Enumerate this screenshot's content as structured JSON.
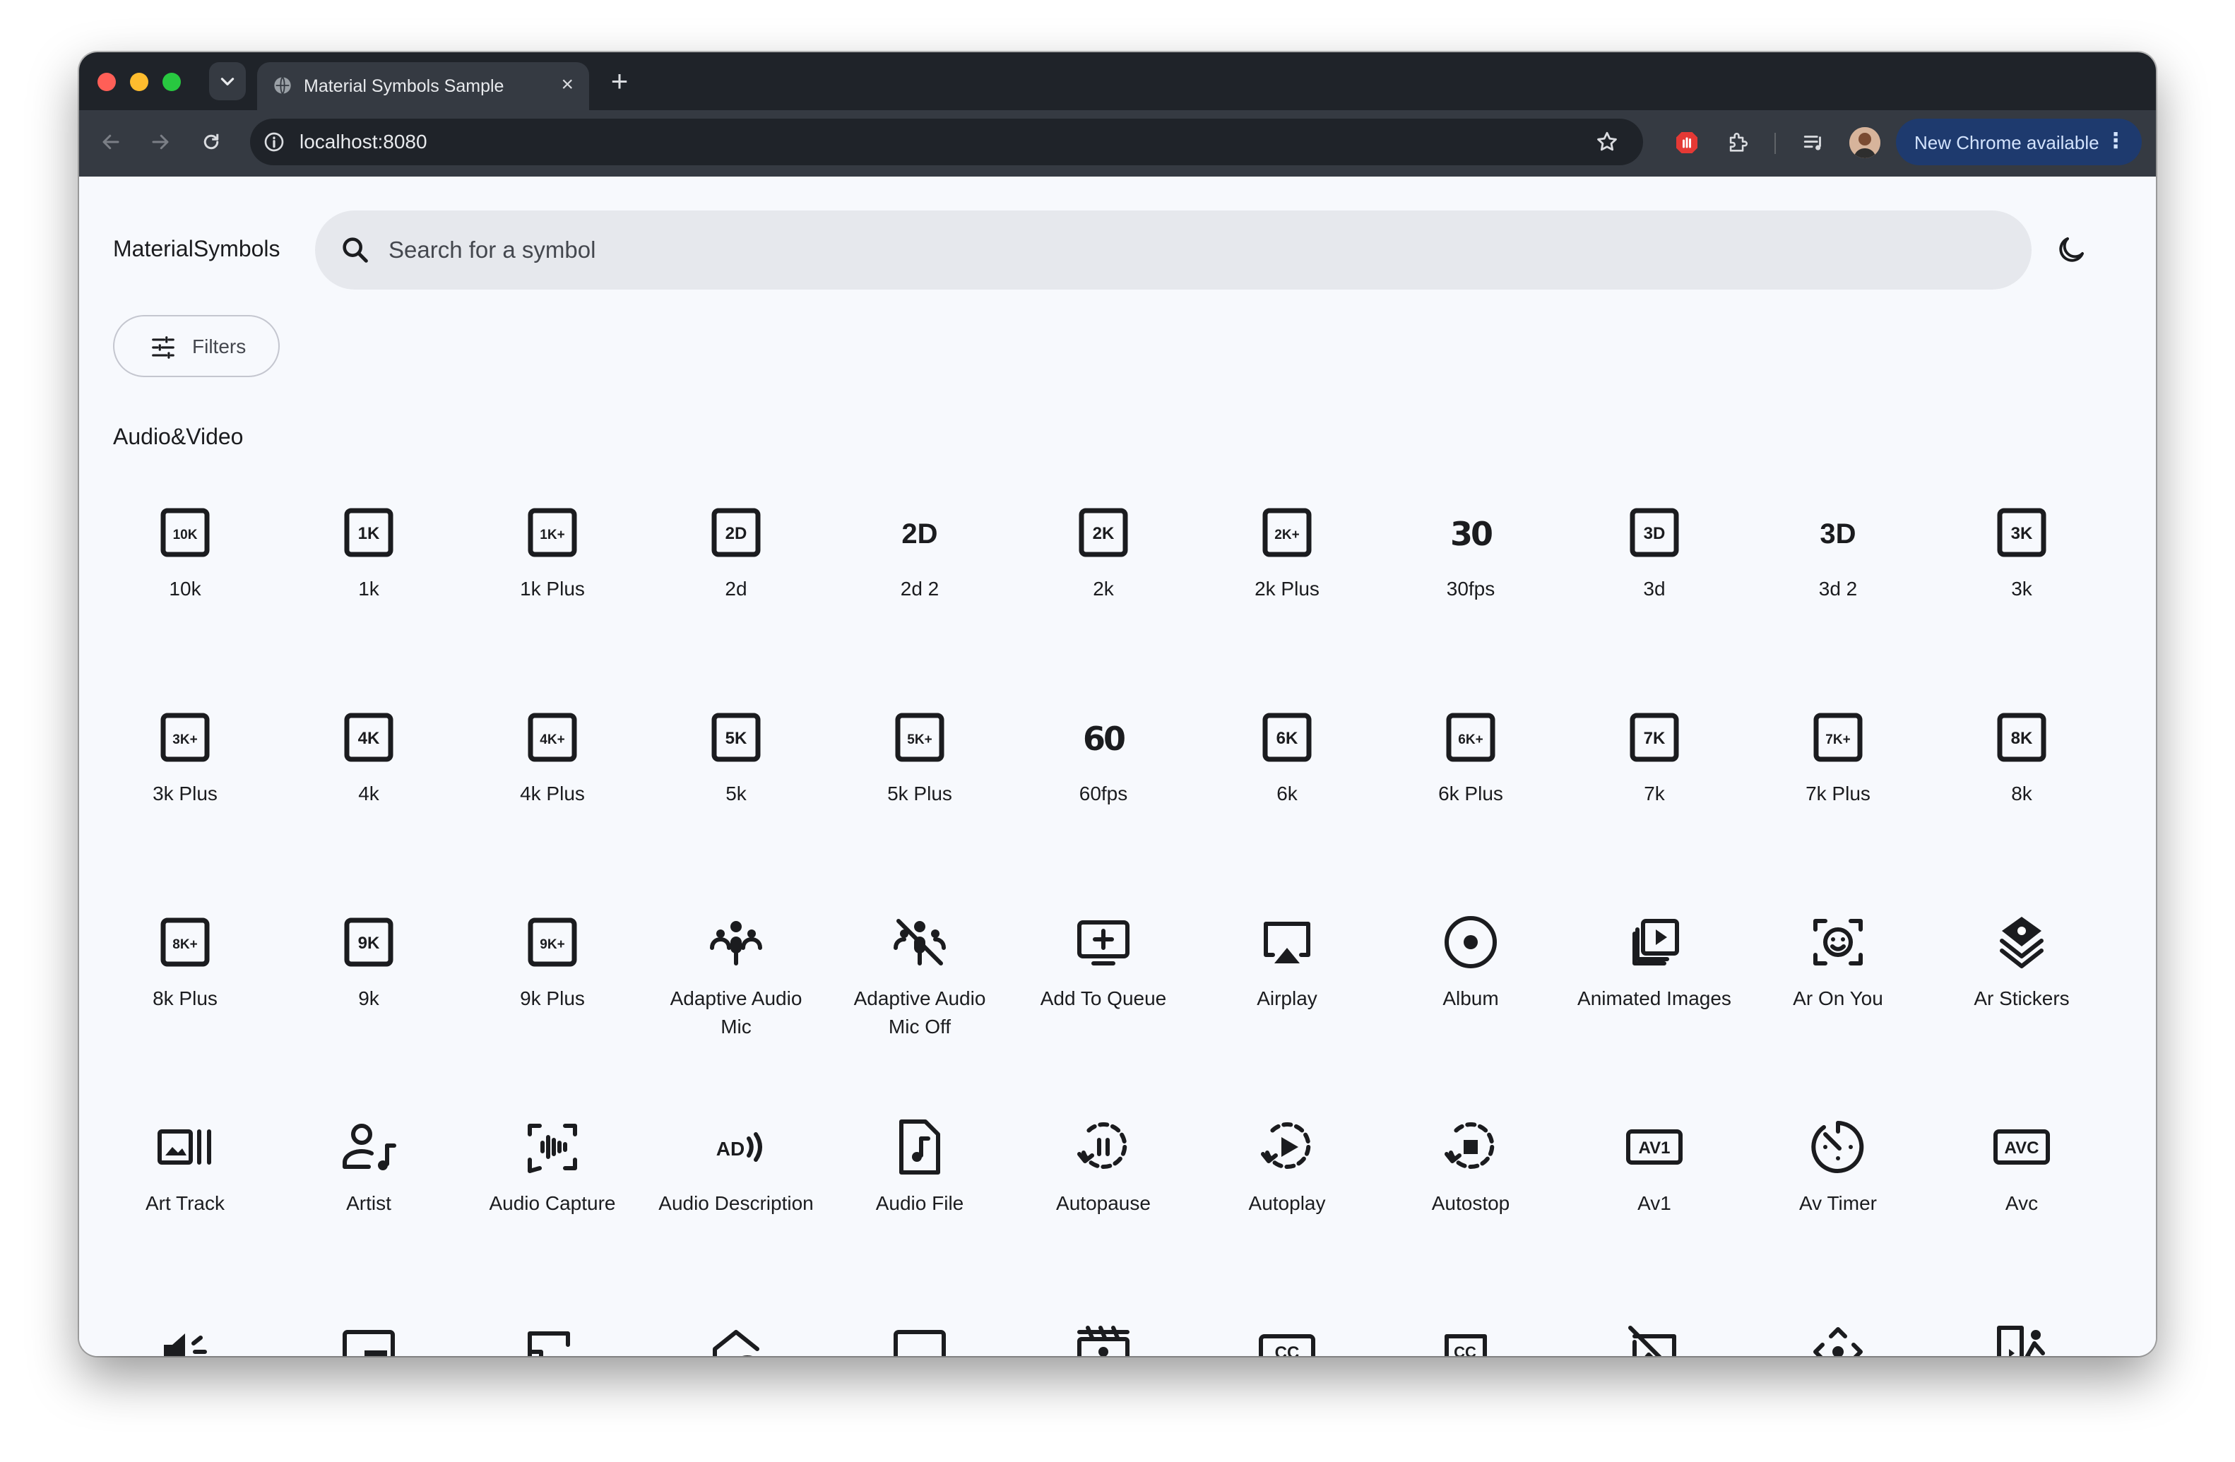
{
  "browser": {
    "tab_title": "Material Symbols Sample",
    "url": "localhost:8080",
    "update_button_label": "New Chrome available"
  },
  "app": {
    "brand": "MaterialSymbols",
    "search": {
      "placeholder": "Search for a symbol"
    },
    "filters_label": "Filters",
    "section_title": "Audio&Video"
  },
  "icons": [
    {
      "label": "10k",
      "icon": "10k-icon"
    },
    {
      "label": "1k",
      "icon": "1k-icon"
    },
    {
      "label": "1k Plus",
      "icon": "1k-plus-icon"
    },
    {
      "label": "2d",
      "icon": "2d-icon"
    },
    {
      "label": "2d 2",
      "icon": "2d-2-icon"
    },
    {
      "label": "2k",
      "icon": "2k-icon"
    },
    {
      "label": "2k Plus",
      "icon": "2k-plus-icon"
    },
    {
      "label": "30fps",
      "icon": "30fps-icon"
    },
    {
      "label": "3d",
      "icon": "3d-icon"
    },
    {
      "label": "3d 2",
      "icon": "3d-2-icon"
    },
    {
      "label": "3k",
      "icon": "3k-icon"
    },
    {
      "label": "3k Plus",
      "icon": "3k-plus-icon"
    },
    {
      "label": "4k",
      "icon": "4k-icon"
    },
    {
      "label": "4k Plus",
      "icon": "4k-plus-icon"
    },
    {
      "label": "5k",
      "icon": "5k-icon"
    },
    {
      "label": "5k Plus",
      "icon": "5k-plus-icon"
    },
    {
      "label": "60fps",
      "icon": "60fps-icon"
    },
    {
      "label": "6k",
      "icon": "6k-icon"
    },
    {
      "label": "6k Plus",
      "icon": "6k-plus-icon"
    },
    {
      "label": "7k",
      "icon": "7k-icon"
    },
    {
      "label": "7k Plus",
      "icon": "7k-plus-icon"
    },
    {
      "label": "8k",
      "icon": "8k-icon"
    },
    {
      "label": "8k Plus",
      "icon": "8k-plus-icon"
    },
    {
      "label": "9k",
      "icon": "9k-icon"
    },
    {
      "label": "9k Plus",
      "icon": "9k-plus-icon"
    },
    {
      "label": "Adaptive Audio Mic",
      "icon": "adaptive-audio-mic-icon"
    },
    {
      "label": "Adaptive Audio Mic Off",
      "icon": "adaptive-audio-mic-off-icon"
    },
    {
      "label": "Add To Queue",
      "icon": "add-to-queue-icon"
    },
    {
      "label": "Airplay",
      "icon": "airplay-icon"
    },
    {
      "label": "Album",
      "icon": "album-icon"
    },
    {
      "label": "Animated Images",
      "icon": "animated-images-icon"
    },
    {
      "label": "Ar On You",
      "icon": "ar-on-you-icon"
    },
    {
      "label": "Ar Stickers",
      "icon": "ar-stickers-icon"
    },
    {
      "label": "Art Track",
      "icon": "art-track-icon"
    },
    {
      "label": "Artist",
      "icon": "artist-icon"
    },
    {
      "label": "Audio Capture",
      "icon": "audio-capture-icon"
    },
    {
      "label": "Audio Description",
      "icon": "audio-description-icon"
    },
    {
      "label": "Audio File",
      "icon": "audio-file-icon"
    },
    {
      "label": "Autopause",
      "icon": "autopause-icon"
    },
    {
      "label": "Autoplay",
      "icon": "autoplay-icon"
    },
    {
      "label": "Autostop",
      "icon": "autostop-icon"
    },
    {
      "label": "Av1",
      "icon": "av1-icon"
    },
    {
      "label": "Av Timer",
      "icon": "av-timer-icon"
    },
    {
      "label": "Avc",
      "icon": "avc-icon"
    },
    {
      "label": "",
      "icon": "volume-icon"
    },
    {
      "label": "",
      "icon": "branding-watermark-icon"
    },
    {
      "label": "",
      "icon": "cast-icon"
    },
    {
      "label": "",
      "icon": "home-cast-icon"
    },
    {
      "label": "",
      "icon": "subtitles-bar-icon"
    },
    {
      "label": "",
      "icon": "movie-person-icon"
    },
    {
      "label": "",
      "icon": "closed-caption-icon"
    },
    {
      "label": "",
      "icon": "closed-caption-add-icon"
    },
    {
      "label": "",
      "icon": "hide-image-icon"
    },
    {
      "label": "",
      "icon": "control-camera-icon"
    },
    {
      "label": "",
      "icon": "door-person-icon"
    }
  ]
}
